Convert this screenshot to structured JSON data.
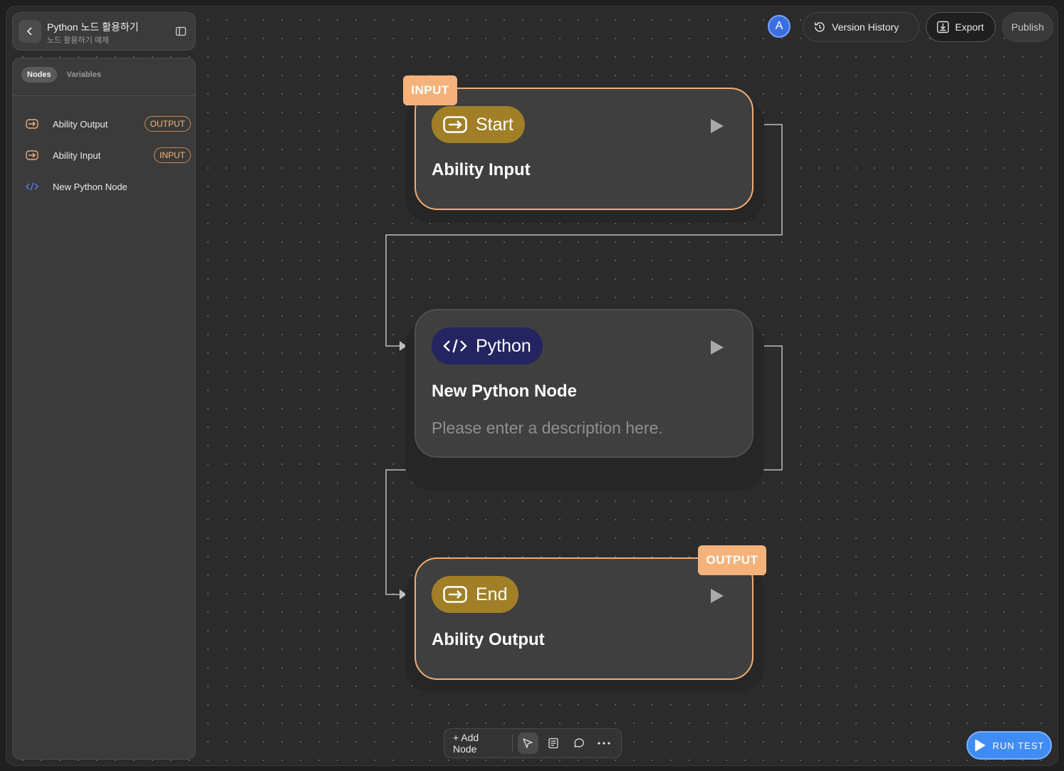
{
  "project": {
    "title": "Python 노드 활용하기",
    "subtitle": "노드 활용하기 예제"
  },
  "sidebar": {
    "tabs": [
      {
        "label": "Nodes",
        "active": true
      },
      {
        "label": "Variables",
        "active": false
      }
    ],
    "items": [
      {
        "label": "Ability Output",
        "icon": "enter-arrow-icon",
        "badge": "OUTPUT"
      },
      {
        "label": "Ability Input",
        "icon": "enter-arrow-icon",
        "badge": "INPUT"
      },
      {
        "label": "New Python Node",
        "icon": "code-icon",
        "badge": ""
      }
    ]
  },
  "header": {
    "avatar": "A",
    "version_history": "Version History",
    "export": "Export",
    "publish": "Publish"
  },
  "nodes": [
    {
      "badge": "INPUT",
      "chip": "Start",
      "title": "Ability Input",
      "description": ""
    },
    {
      "badge": "",
      "chip": "Python",
      "title": "New Python Node",
      "description": "Please enter a description here."
    },
    {
      "badge": "OUTPUT",
      "chip": "End",
      "title": "Ability Output",
      "description": ""
    }
  ],
  "toolbar": {
    "add_node": "+ Add Node"
  },
  "run_test": "RUN TEST",
  "colors": {
    "accent_orange": "#f5b27a",
    "gold_chip": "#a07f27",
    "navy_chip": "#232460",
    "run_blue": "#3f8cf5"
  }
}
